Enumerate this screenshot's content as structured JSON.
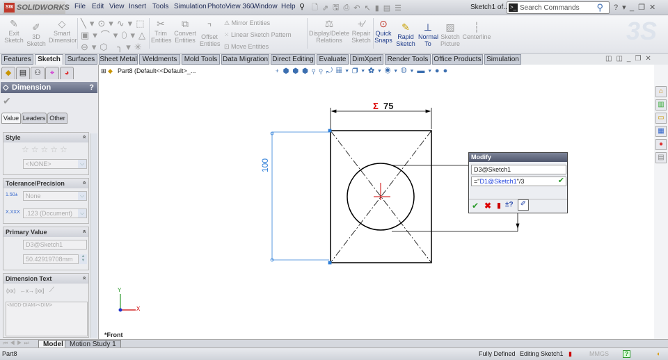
{
  "app": {
    "logo": "SOLIDWORKS",
    "doc_title": "Sketch1 of...",
    "search_placeholder": "Search Commands"
  },
  "menu": [
    "File",
    "Edit",
    "View",
    "Insert",
    "Tools",
    "Simulation",
    "PhotoView 360",
    "Window",
    "Help"
  ],
  "ribbon": {
    "exit_sketch": "Exit Sketch",
    "sketch_3d": "3D Sketch",
    "smart_dimension": "Smart Dimension",
    "trim": "Trim Entities",
    "convert": "Convert Entities",
    "offset": "Offset Entities",
    "mirror": "Mirror Entities",
    "linear_pattern": "Linear Sketch Pattern",
    "move": "Move Entities",
    "display_delete": "Display/Delete Relations",
    "repair": "Repair Sketch",
    "quick_snaps": "Quick Snaps",
    "rapid_sketch": "Rapid Sketch",
    "normal_to": "Normal To",
    "sketch_picture": "Sketch Picture",
    "centerline": "Centerline"
  },
  "tabs": [
    "Features",
    "Sketch",
    "Surfaces",
    "Sheet Metal",
    "Weldments",
    "Mold Tools",
    "Data Migration",
    "Direct Editing",
    "Evaluate",
    "DimXpert",
    "Render Tools",
    "Office Products",
    "Simulation"
  ],
  "panel": {
    "title": "Dimension",
    "help": "?",
    "subtabs": [
      "Value",
      "Leaders",
      "Other"
    ],
    "style": {
      "title": "Style",
      "select": "<NONE>"
    },
    "tolerance": {
      "title": "Tolerance/Precision",
      "type": "None",
      "precision": ".123 (Document)"
    },
    "primary": {
      "title": "Primary Value",
      "name": "D3@Sketch1",
      "value": "50.42919708mm"
    },
    "dimtext": {
      "title": "Dimension Text",
      "text": "<MOD-DIAM><DIM>",
      "buttons": [
        "(xx)",
        "←x→",
        "[xx]"
      ]
    }
  },
  "tree": {
    "label": "Part8  (Default<<Default>_..."
  },
  "drawing": {
    "dim_top": "75",
    "dim_top_prefix": "Σ",
    "dim_left": "100",
    "view_label": "*Front",
    "axis_x": "X",
    "axis_y": "Y"
  },
  "modify": {
    "title": "Modify",
    "name": "D3@Sketch1",
    "eq_prefix": "=\"",
    "eq_ref": "D1@Sketch1",
    "eq_suffix": "\"/3"
  },
  "bottom_tabs": [
    "Model",
    "Motion Study 1"
  ],
  "status": {
    "part": "Part8",
    "defined": "Fully Defined",
    "editing": "Editing Sketch1",
    "units": "MMGS",
    "help": "?"
  },
  "colors": {
    "dim_blue": "#2f7fd8",
    "red": "#c0392b",
    "green": "#2a9a2a"
  }
}
